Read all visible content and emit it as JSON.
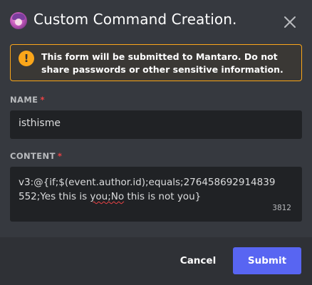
{
  "modal": {
    "title": "Custom Command Creation.",
    "close_icon": "close-icon"
  },
  "warning": {
    "icon": "exclamation-icon",
    "text_prefix": "This form will be submitted to ",
    "bot_name": "Mantaro",
    "text_suffix": ". Do not share passwords or other sensitive information.",
    "accent_color": "#faa61a"
  },
  "fields": {
    "name": {
      "label": "NAME",
      "required_marker": "*",
      "value": "isthisme"
    },
    "content": {
      "label": "CONTENT",
      "required_marker": "*",
      "value_line1": "v3:@{if;$(event.author.id);equals;276458692914839",
      "value_line2_pre": "552;Yes this is ",
      "value_line2_misspelled": "you;No",
      "value_line2_post": " this is not you}",
      "remaining_chars": "3812"
    }
  },
  "footer": {
    "cancel_label": "Cancel",
    "submit_label": "Submit",
    "submit_color": "#5865f2"
  }
}
